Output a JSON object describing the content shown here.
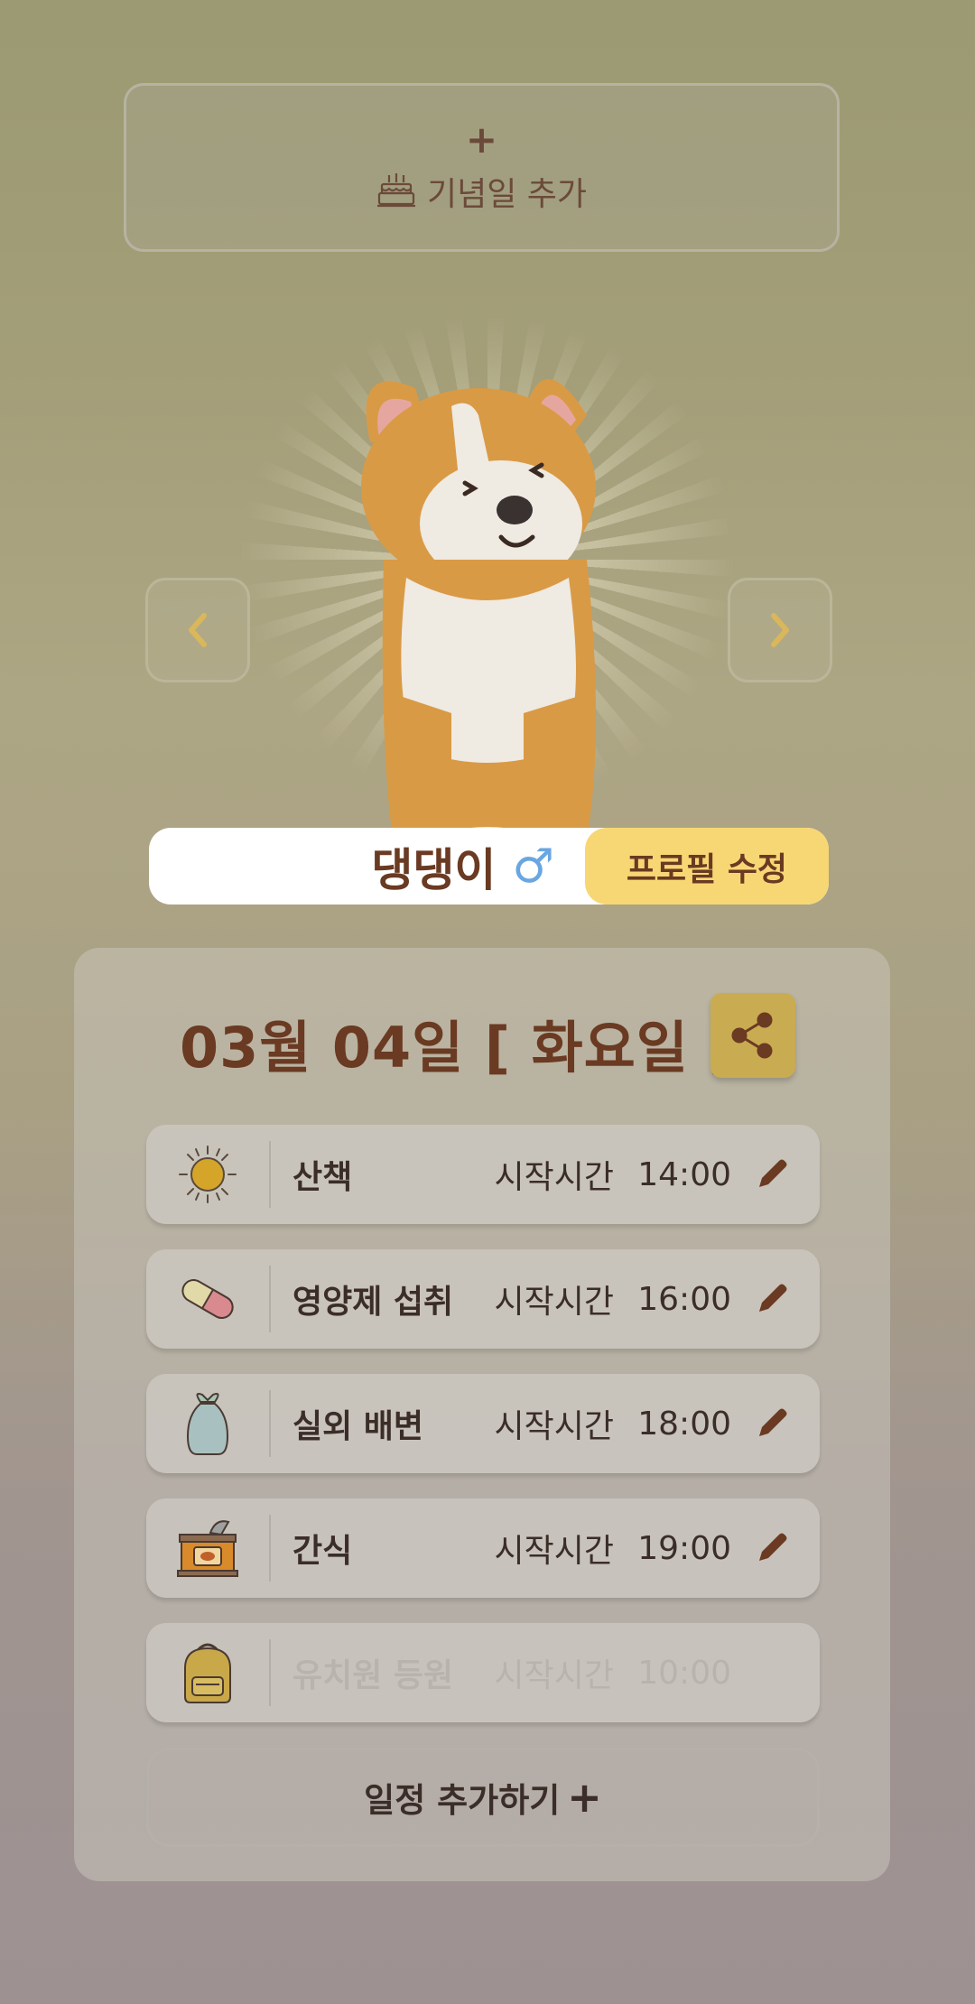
{
  "anniversary": {
    "plus": "+",
    "label": "기념일 추가",
    "icon": "cake-icon"
  },
  "profile": {
    "name": "댕댕이",
    "gender_symbol": "♂",
    "edit_label": "프로필 수정",
    "prev_icon": "chevron-left-icon",
    "next_icon": "chevron-right-icon"
  },
  "schedule": {
    "date": "03월 04일 [ 화요일 ]",
    "share_icon": "share-icon",
    "items": [
      {
        "title": "산책",
        "start_label": "시작시간",
        "time": "14:00",
        "icon": "sun-icon",
        "enabled": true
      },
      {
        "title": "영양제 섭취",
        "start_label": "시작시간",
        "time": "16:00",
        "icon": "pill-icon",
        "enabled": true
      },
      {
        "title": "실외 배변",
        "start_label": "시작시간",
        "time": "18:00",
        "icon": "waste-bag-icon",
        "enabled": true
      },
      {
        "title": "간식",
        "start_label": "시작시간",
        "time": "19:00",
        "icon": "canned-food-icon",
        "enabled": true
      },
      {
        "title": "유치원 등원",
        "start_label": "시작시간",
        "time": "10:00",
        "icon": "backpack-icon",
        "enabled": false
      }
    ],
    "add_label": "일정 추가하기",
    "add_plus": "+"
  },
  "colors": {
    "accent": "#f7d774",
    "brown": "#6a3a22",
    "gender": "#6aa6e0",
    "share_bg": "#c9ab52"
  }
}
